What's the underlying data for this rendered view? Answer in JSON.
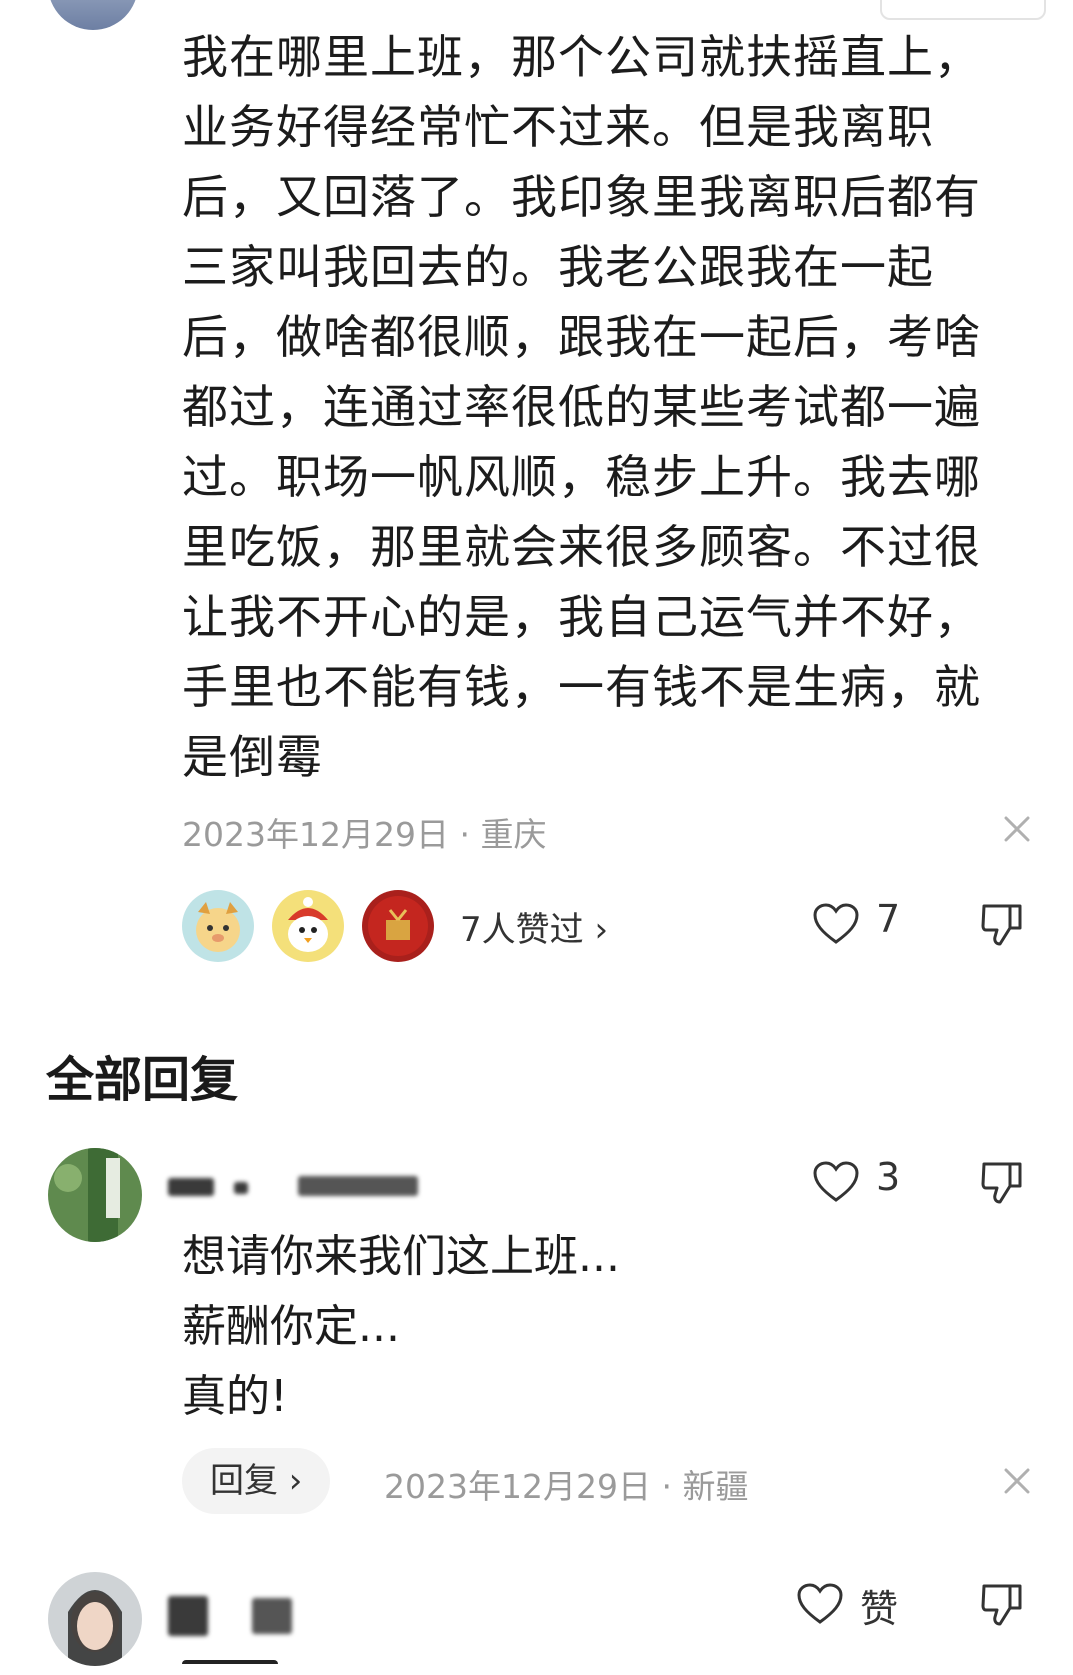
{
  "comment": {
    "lines": [
      "我在哪里上班，那个公司就扶摇直上，",
      "业务好得经常忙不过来。但是我离职",
      "后，又回落了。我印象里我离职后都有",
      "三家叫我回去的。我老公跟我在一起",
      "后，做啥都很顺，跟我在一起后，考啥",
      "都过，连通过率很低的某些考试都一遍",
      "过。职场一帆风顺，稳步上升。我去哪",
      "里吃饭，那里就会来很多顾客。不过很",
      "让我不开心的是，我自己运气并不好，",
      "手里也不能有钱，一有钱不是生病，就",
      "是倒霉"
    ],
    "date": "2023年12月29日",
    "location": "· 重庆",
    "likers_text": "7人赞过 ›",
    "like_count": "7"
  },
  "section_title": "全部回复",
  "replies": [
    {
      "lines": [
        "想请你来我们这上班...",
        "薪酬你定...",
        "真的!"
      ],
      "reply_label": "回复 ›",
      "date": "2023年12月29日",
      "location": "· 新疆",
      "like_count": "3"
    },
    {
      "like_label": "赞"
    }
  ],
  "colors": {
    "text": "#1c1c1c",
    "meta": "#9a9a9a",
    "reply_button_bg": "#f3f3f3"
  }
}
